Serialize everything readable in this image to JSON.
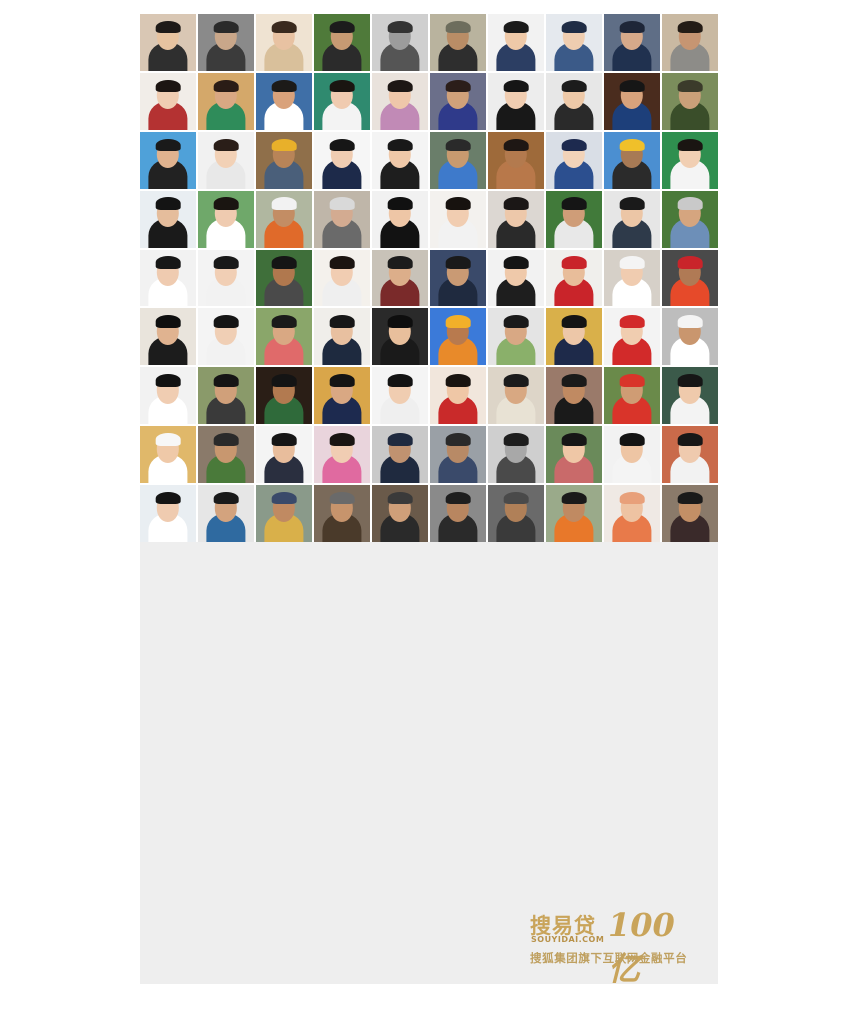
{
  "brand": {
    "name": "搜易贷",
    "domain": "SOUYIDAI.COM",
    "amount": "100亿",
    "tagline": "搜狐集团旗下互联网金融平台"
  },
  "mosaic": {
    "rows": 9,
    "cols": 10,
    "tiles": [
      {
        "bg": "#d9c7b4",
        "shirt": "#2f2f2f",
        "skin": "#e7c3a0",
        "hair": "#1e1a18"
      },
      {
        "bg": "#8a8a8a",
        "shirt": "#3b3b3b",
        "skin": "#c9a78a",
        "hair": "#2a2a2a"
      },
      {
        "bg": "#efe3d2",
        "shirt": "#d9c09b",
        "skin": "#e8c2a2",
        "hair": "#3a2a1e"
      },
      {
        "bg": "#4f7a3a",
        "shirt": "#2b2b2b",
        "skin": "#c79a73",
        "hair": "#1c1c1c"
      },
      {
        "bg": "#cfcfcf",
        "shirt": "#555555",
        "skin": "#9c9c9c",
        "hair": "#333333"
      },
      {
        "bg": "#b9b39e",
        "shirt": "#2e2e2e",
        "skin": "#b98d66",
        "hair": "#6d6d5d"
      },
      {
        "bg": "#f2f2f2",
        "shirt": "#2c3e63",
        "skin": "#efc9a8",
        "hair": "#1b1b1b"
      },
      {
        "bg": "#e5e9ee",
        "shirt": "#3b5a88",
        "skin": "#efcdb0",
        "hair": "#1f2c45"
      },
      {
        "bg": "#5f6e86",
        "shirt": "#20314f",
        "skin": "#d6a98a",
        "hair": "#1e2638"
      },
      {
        "bg": "#c9b9a2",
        "shirt": "#8d8c88",
        "skin": "#c69572",
        "hair": "#241c16"
      },
      {
        "bg": "#f1ede8",
        "shirt": "#b43232",
        "skin": "#f0cdb2",
        "hair": "#1c1512"
      },
      {
        "bg": "#d4a86a",
        "shirt": "#2f8c5a",
        "skin": "#d9a883",
        "hair": "#2a1c16"
      },
      {
        "bg": "#3f6fa7",
        "shirt": "#ffffff",
        "skin": "#d9a27b",
        "hair": "#1c1a18"
      },
      {
        "bg": "#2f8a6f",
        "shirt": "#f3f3f3",
        "skin": "#f0cbb0",
        "hair": "#1a1511"
      },
      {
        "bg": "#e9e2dc",
        "shirt": "#c18ab6",
        "skin": "#efc7aa",
        "hair": "#1d1715"
      },
      {
        "bg": "#6b6f8a",
        "shirt": "#2f3a8a",
        "skin": "#d0a17a",
        "hair": "#2b1e1a"
      },
      {
        "bg": "#ededed",
        "shirt": "#181818",
        "skin": "#f0cdb1",
        "hair": "#151515"
      },
      {
        "bg": "#e7e7e7",
        "shirt": "#2a2a2a",
        "skin": "#eec9a8",
        "hair": "#1c1c1c"
      },
      {
        "bg": "#4a2c1e",
        "shirt": "#1d3f7a",
        "skin": "#d7a27c",
        "hair": "#161616"
      },
      {
        "bg": "#7b8d5c",
        "shirt": "#3a4e2a",
        "skin": "#caa079",
        "hair": "#3b3b2b"
      },
      {
        "bg": "#4fa1d9",
        "shirt": "#222222",
        "skin": "#e0b38f",
        "hair": "#1a1a1a"
      },
      {
        "bg": "#f1f1f1",
        "shirt": "#e8e8e8",
        "skin": "#f2d1b6",
        "hair": "#2a1e18"
      },
      {
        "bg": "#8f6f4a",
        "shirt": "#4a5f7a",
        "skin": "#b88458",
        "hair": "#e8b02a"
      },
      {
        "bg": "#f6f6f6",
        "shirt": "#1d2a4a",
        "skin": "#f0cdb2",
        "hair": "#161616"
      },
      {
        "bg": "#f4f4f4",
        "shirt": "#1e1e1e",
        "skin": "#efc8a8",
        "hair": "#191919"
      },
      {
        "bg": "#6a7e6a",
        "shirt": "#3e7acb",
        "skin": "#c89a6f",
        "hair": "#2a2a2a"
      },
      {
        "bg": "#9e6a3a",
        "shirt": "#b8784a",
        "skin": "#b37a4e",
        "hair": "#1e1714"
      },
      {
        "bg": "#d9dee6",
        "shirt": "#2c4f8f",
        "skin": "#f2d3b9",
        "hair": "#1d2a4f"
      },
      {
        "bg": "#4b8fd1",
        "shirt": "#2b2b2b",
        "skin": "#a77a55",
        "hair": "#f0c02a"
      },
      {
        "bg": "#2f8f4f",
        "shirt": "#f4f4f4",
        "skin": "#f1cfb3",
        "hair": "#1a1512"
      },
      {
        "bg": "#e9eef2",
        "shirt": "#1a1a1a",
        "skin": "#e5bd9c",
        "hair": "#141414"
      },
      {
        "bg": "#6fa86a",
        "shirt": "#ffffff",
        "skin": "#efcbb0",
        "hair": "#1a1511"
      },
      {
        "bg": "#b0b7a0",
        "shirt": "#e06a2a",
        "skin": "#c38d64",
        "hair": "#f2f2f2"
      },
      {
        "bg": "#bfb6a9",
        "shirt": "#6a6a6a",
        "skin": "#d3ab91",
        "hair": "#d9d9d9"
      },
      {
        "bg": "#f1f1f1",
        "shirt": "#121212",
        "skin": "#eec6a6",
        "hair": "#111111"
      },
      {
        "bg": "#f3f1ee",
        "shirt": "#f2f2f2",
        "skin": "#f1cdb1",
        "hair": "#17120f"
      },
      {
        "bg": "#dcd7d2",
        "shirt": "#2a2a2a",
        "skin": "#edc8aa",
        "hair": "#1b1716"
      },
      {
        "bg": "#417a3a",
        "shirt": "#e8e8e8",
        "skin": "#cf9d78",
        "hair": "#151515"
      },
      {
        "bg": "#e6e6e6",
        "shirt": "#2e3a4a",
        "skin": "#ecc6a6",
        "hair": "#1a1a1a"
      },
      {
        "bg": "#4a7a3a",
        "shirt": "#6d8fb8",
        "skin": "#d5a57f",
        "hair": "#c9c9c9"
      },
      {
        "bg": "#f2f2f2",
        "shirt": "#ffffff",
        "skin": "#efcbb0",
        "hair": "#171717"
      },
      {
        "bg": "#f3f3f3",
        "shirt": "#f2f2f2",
        "skin": "#f1cfb5",
        "hair": "#191919"
      },
      {
        "bg": "#3f6f3a",
        "shirt": "#4a4a4a",
        "skin": "#b0784e",
        "hair": "#151515"
      },
      {
        "bg": "#f4f1ec",
        "shirt": "#efefef",
        "skin": "#f1cdb2",
        "hair": "#1b1410"
      },
      {
        "bg": "#c8c2b8",
        "shirt": "#7a2a2a",
        "skin": "#dcae8a",
        "hair": "#1c1c1c"
      },
      {
        "bg": "#3a4a6a",
        "shirt": "#1f2a3f",
        "skin": "#c99a74",
        "hair": "#1a1a1a"
      },
      {
        "bg": "#f2f2f2",
        "shirt": "#1e1e1e",
        "skin": "#efc9aa",
        "hair": "#151515"
      },
      {
        "bg": "#f0efec",
        "shirt": "#c9242a",
        "skin": "#e8bd9a",
        "hair": "#c9242a"
      },
      {
        "bg": "#d6d0c8",
        "shirt": "#ffffff",
        "skin": "#f0ccb0",
        "hair": "#f4f4f4"
      },
      {
        "bg": "#4a4a4a",
        "shirt": "#e64a2a",
        "skin": "#b07a55",
        "hair": "#c9242a"
      },
      {
        "bg": "#e9e4dc",
        "shirt": "#1c1c1c",
        "skin": "#e0b390",
        "hair": "#0f0f0f"
      },
      {
        "bg": "#f4f4f4",
        "shirt": "#f2f2f2",
        "skin": "#f0cfb5",
        "hair": "#151515"
      },
      {
        "bg": "#8aa66a",
        "shirt": "#e06a6a",
        "skin": "#d9a883",
        "hair": "#1a1a1a"
      },
      {
        "bg": "#f0eeea",
        "shirt": "#1e2a3f",
        "skin": "#e8c0a0",
        "hair": "#171717"
      },
      {
        "bg": "#2a2a2a",
        "shirt": "#1a1a1a",
        "skin": "#e8bf9c",
        "hair": "#0e0e0e"
      },
      {
        "bg": "#3b7ad9",
        "shirt": "#e88a2a",
        "skin": "#b87a4e",
        "hair": "#f2b02a"
      },
      {
        "bg": "#e4e4e4",
        "shirt": "#8ab06a",
        "skin": "#d8a884",
        "hair": "#1a1a1a"
      },
      {
        "bg": "#d9b04a",
        "shirt": "#1e2a4a",
        "skin": "#edc7a8",
        "hair": "#141414"
      },
      {
        "bg": "#f3f3f3",
        "shirt": "#d22a2a",
        "skin": "#f0cdb0",
        "hair": "#d22a2a"
      },
      {
        "bg": "#bdbdbd",
        "shirt": "#ffffff",
        "skin": "#c9966e",
        "hair": "#f4f4f4"
      },
      {
        "bg": "#f2f2f2",
        "shirt": "#ffffff",
        "skin": "#f0cdb2",
        "hair": "#121212"
      },
      {
        "bg": "#8a9a6a",
        "shirt": "#3a3a3a",
        "skin": "#d0a07a",
        "hair": "#151515"
      },
      {
        "bg": "#2a1e16",
        "shirt": "#2f6a3a",
        "skin": "#b27a50",
        "hair": "#141414"
      },
      {
        "bg": "#d9a64a",
        "shirt": "#1d2a4f",
        "skin": "#d9a883",
        "hair": "#141414"
      },
      {
        "bg": "#f4f4f4",
        "shirt": "#efefef",
        "skin": "#f0cdb1",
        "hair": "#131313"
      },
      {
        "bg": "#f1e6dc",
        "shirt": "#c92a2a",
        "skin": "#efc7a6",
        "hair": "#1a1410"
      },
      {
        "bg": "#ddd5c8",
        "shirt": "#e8e2d4",
        "skin": "#d8a882",
        "hair": "#1b1b1b"
      },
      {
        "bg": "#9a7a6a",
        "shirt": "#1a1a1a",
        "skin": "#c08a62",
        "hair": "#1a1a1a"
      },
      {
        "bg": "#6a8a4a",
        "shirt": "#d9342a",
        "skin": "#cf9c74",
        "hair": "#d9342a"
      },
      {
        "bg": "#3b5a4a",
        "shirt": "#f3f3f3",
        "skin": "#efcaac",
        "hair": "#161616"
      },
      {
        "bg": "#e0b86a",
        "shirt": "#ffffff",
        "skin": "#efc9a8",
        "hair": "#f7f7f7"
      },
      {
        "bg": "#8a7a6a",
        "shirt": "#4a7a3a",
        "skin": "#c8976f",
        "hair": "#2a2a2a"
      },
      {
        "bg": "#f4f4f4",
        "shirt": "#2a2f3f",
        "skin": "#e8bd9c",
        "hair": "#161616"
      },
      {
        "bg": "#e9d4dc",
        "shirt": "#e06aa0",
        "skin": "#f1cdb3",
        "hair": "#1a1512"
      },
      {
        "bg": "#c9c9c9",
        "shirt": "#1f2a3f",
        "skin": "#c09270",
        "hair": "#1f2a3f"
      },
      {
        "bg": "#9aa0a6",
        "shirt": "#3a4a6a",
        "skin": "#b88a66",
        "hair": "#2a2a2a"
      },
      {
        "bg": "#cfcfcf",
        "shirt": "#4a4a4a",
        "skin": "#a8a8a8",
        "hair": "#1e1e1e"
      },
      {
        "bg": "#6a8a5a",
        "shirt": "#c96a6a",
        "skin": "#efc7a6",
        "hair": "#161616"
      },
      {
        "bg": "#f2f2f2",
        "shirt": "#f4f4f4",
        "skin": "#eec5a4",
        "hair": "#141414"
      },
      {
        "bg": "#c96a4a",
        "shirt": "#f2f2f2",
        "skin": "#efcaae",
        "hair": "#171717"
      },
      {
        "bg": "#e9eef2",
        "shirt": "#ffffff",
        "skin": "#efcbb0",
        "hair": "#141414"
      },
      {
        "bg": "#e6e6e6",
        "shirt": "#2f6aa0",
        "skin": "#d3a37e",
        "hair": "#1a1a1a"
      },
      {
        "bg": "#8a9a8a",
        "shirt": "#d9b04a",
        "skin": "#c08a62",
        "hair": "#3a4a6a"
      },
      {
        "bg": "#7a6a5a",
        "shirt": "#4a3a2a",
        "skin": "#c7946c",
        "hair": "#6a6a6a"
      },
      {
        "bg": "#6a5a4a",
        "shirt": "#2a2a2a",
        "skin": "#cf9f79",
        "hair": "#3a3a3a"
      },
      {
        "bg": "#8a8a8a",
        "shirt": "#2a2a2a",
        "skin": "#b88660",
        "hair": "#1e1e1e"
      },
      {
        "bg": "#6a6a6a",
        "shirt": "#3a3a3a",
        "skin": "#b08058",
        "hair": "#4a4a4a"
      },
      {
        "bg": "#9aaa8a",
        "shirt": "#e8782a",
        "skin": "#c08a62",
        "hair": "#1a1a1a"
      },
      {
        "bg": "#efe9e4",
        "shirt": "#e87a4a",
        "skin": "#eec3a2",
        "hair": "#e8a07a"
      },
      {
        "bg": "#8a7a6a",
        "shirt": "#3a2a2a",
        "skin": "#c38f66",
        "hair": "#1a1a1a"
      }
    ]
  }
}
